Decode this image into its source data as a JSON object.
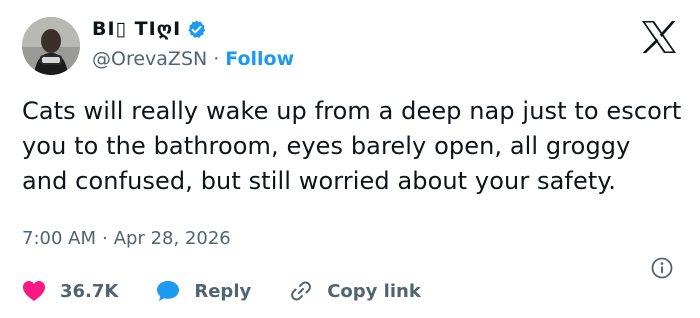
{
  "user": {
    "display_name": "BI▯ TIღI",
    "handle": "@OrevaZSN",
    "separator": "·",
    "follow_label": "Follow"
  },
  "tweet": {
    "text": "Cats will really wake up from a deep nap just to escort you to the bathroom, eyes barely open, all groggy and confused, but still worried about your safety.",
    "time": "7:00 AM",
    "separator": "·",
    "date": "Apr 28, 2026"
  },
  "actions": {
    "like_count": "36.7K",
    "reply_label": "Reply",
    "copy_link_label": "Copy link"
  },
  "colors": {
    "accent": "#1d9bf0",
    "like": "#f91880",
    "muted": "#536471",
    "text": "#0f1419"
  },
  "icons": {
    "verified": "verified-badge-icon",
    "x_logo": "x-logo-icon",
    "info": "info-icon",
    "like": "heart-icon",
    "reply": "speech-bubble-icon",
    "copy_link": "link-icon"
  }
}
